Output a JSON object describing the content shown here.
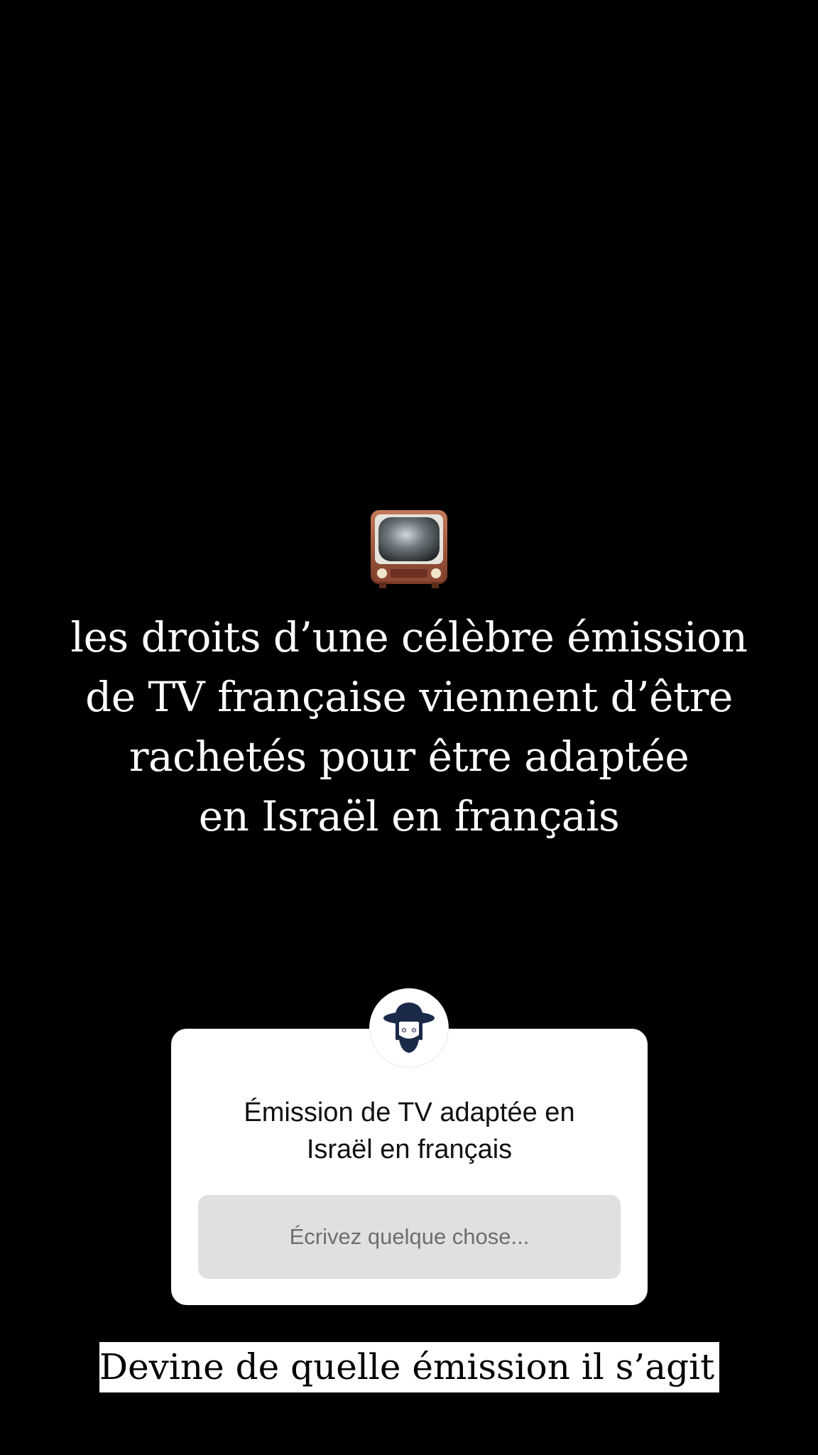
{
  "story": {
    "icon": "television-icon",
    "headline_lines": [
      "les droits d’une célèbre émission",
      "de TV française viennent d’être",
      "rachetés pour être adaptée",
      "en Israël en français"
    ]
  },
  "question_sticker": {
    "avatar_icon": "profile-avatar-icon",
    "question_lines": [
      "Émission de TV adaptée en",
      "Israël en français"
    ],
    "answer_placeholder": "Écrivez quelque chose..."
  },
  "caption": "Devine de quelle émission il s’agit !",
  "colors": {
    "background": "#000000",
    "card": "#ffffff",
    "field": "#e0e0e0",
    "avatar_navy": "#1c2a4a"
  }
}
